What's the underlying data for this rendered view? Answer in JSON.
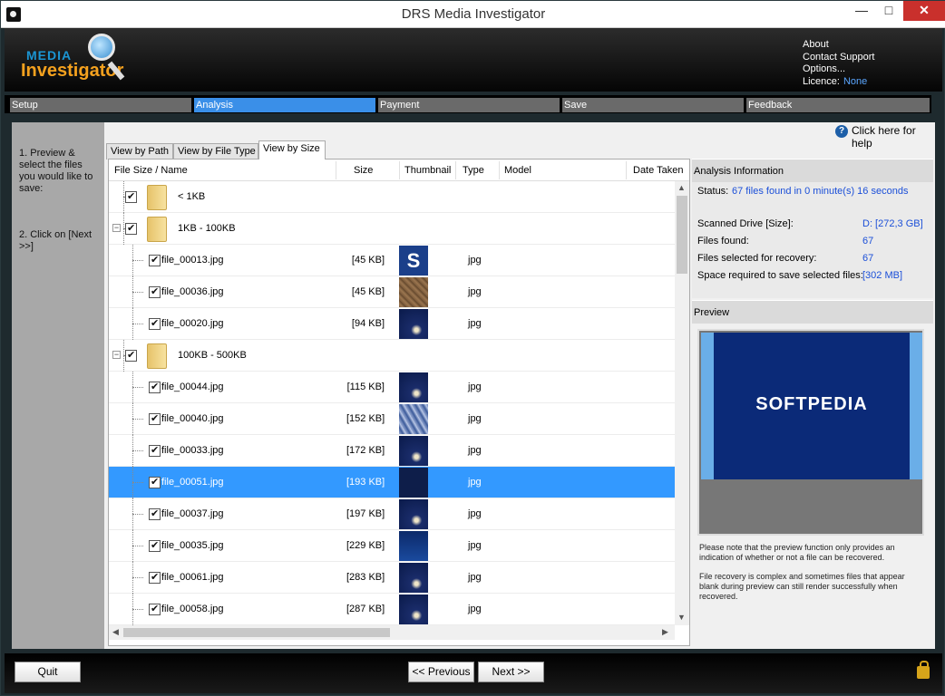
{
  "window": {
    "title": "DRS Media Investigator"
  },
  "logo": {
    "line1": "MEDIA",
    "line2": "Investigator"
  },
  "toplinks": {
    "about": "About",
    "support": "Contact Support",
    "options": "Options...",
    "licence_label": "Licence:",
    "licence_value": "None"
  },
  "steps": [
    "Setup",
    "Analysis",
    "Payment",
    "Save",
    "Feedback"
  ],
  "active_step": "Analysis",
  "instructions": {
    "step1": "1. Preview & select the files you would like to save:",
    "step2": "2. Click on [Next >>]"
  },
  "help": {
    "label": "Click here for help"
  },
  "tabs": [
    "View by Path",
    "View by File Type",
    "View by Size"
  ],
  "active_tab": "View by Size",
  "columns": [
    "File Size / Name",
    "Size",
    "Thumbnail",
    "Type",
    "Model",
    "Date Taken"
  ],
  "rows": [
    {
      "kind": "group",
      "name": "< 1KB",
      "size": "",
      "type": "",
      "thumb": ""
    },
    {
      "kind": "group",
      "name": "1KB - 100KB",
      "size": "",
      "type": "",
      "thumb": ""
    },
    {
      "kind": "file",
      "name": "file_00013.jpg",
      "size": "[45 KB]",
      "type": "jpg",
      "thumb": "logo"
    },
    {
      "kind": "file",
      "name": "file_00036.jpg",
      "size": "[45 KB]",
      "type": "jpg",
      "thumb": "texture"
    },
    {
      "kind": "file",
      "name": "file_00020.jpg",
      "size": "[94 KB]",
      "type": "jpg",
      "thumb": "night"
    },
    {
      "kind": "group",
      "name": "100KB - 500KB",
      "size": "",
      "type": "",
      "thumb": ""
    },
    {
      "kind": "file",
      "name": "file_00044.jpg",
      "size": "[115 KB]",
      "type": "jpg",
      "thumb": "night"
    },
    {
      "kind": "file",
      "name": "file_00040.jpg",
      "size": "[152 KB]",
      "type": "jpg",
      "thumb": "crystal"
    },
    {
      "kind": "file",
      "name": "file_00033.jpg",
      "size": "[172 KB]",
      "type": "jpg",
      "thumb": "night"
    },
    {
      "kind": "file",
      "name": "file_00051.jpg",
      "size": "[193 KB]",
      "type": "jpg",
      "thumb": "dark",
      "selected": true
    },
    {
      "kind": "file",
      "name": "file_00037.jpg",
      "size": "[197 KB]",
      "type": "jpg",
      "thumb": "night"
    },
    {
      "kind": "file",
      "name": "file_00035.jpg",
      "size": "[229 KB]",
      "type": "jpg",
      "thumb": "blue"
    },
    {
      "kind": "file",
      "name": "file_00061.jpg",
      "size": "[283 KB]",
      "type": "jpg",
      "thumb": "night"
    },
    {
      "kind": "file",
      "name": "file_00058.jpg",
      "size": "[287 KB]",
      "type": "jpg",
      "thumb": "night"
    }
  ],
  "analysis": {
    "header": "Analysis Information",
    "status_label": "Status:",
    "status_value": "67 files found in 0 minute(s) 16 seconds",
    "drive_label": "Scanned Drive [Size]:",
    "drive_value": "D:  [272,3 GB]",
    "found_label": "Files found:",
    "found_value": "67",
    "selected_label": "Files selected for recovery:",
    "selected_value": "67",
    "space_label": "Space required to save selected files:",
    "space_value": "[302 MB]"
  },
  "preview": {
    "header": "Preview",
    "image_text": "SOFTPEDIA",
    "note1": "Please note that the preview function only provides an indication of whether or not a file can be recovered.",
    "note2": "File recovery is complex and sometimes files that appear blank during preview can still render successfully when recovered."
  },
  "footer": {
    "quit": "Quit",
    "previous": "<< Previous",
    "next": "Next >>"
  },
  "colors": {
    "accent": "#3399ff",
    "active_step": "#3a8fe8",
    "link": "#1b4fd8"
  }
}
